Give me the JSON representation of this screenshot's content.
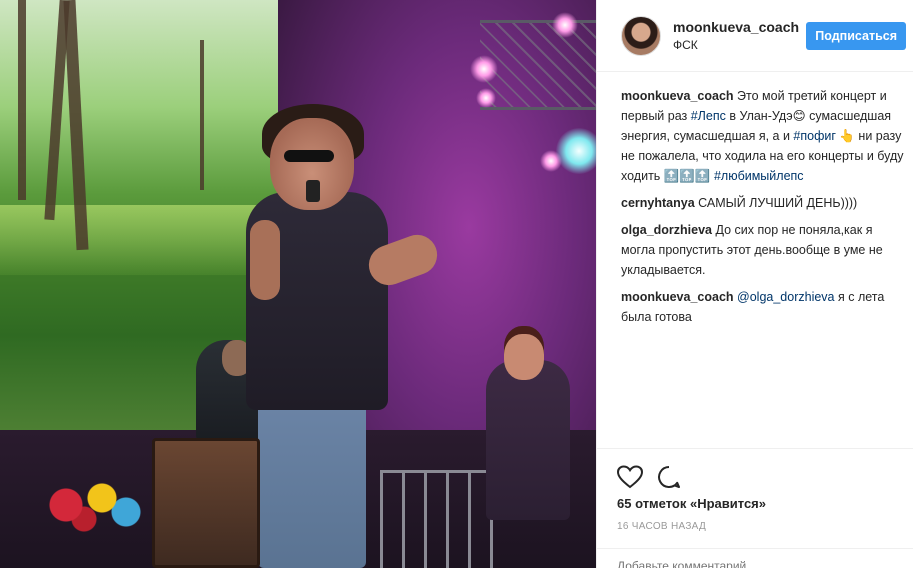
{
  "header": {
    "username": "moonkueva_coach",
    "location": "ФСК",
    "follow_label": "Подписаться"
  },
  "comments": [
    {
      "user": "moonkueva_coach",
      "parts": [
        {
          "text": "Это мой третий концерт и первый раз ",
          "tag": false
        },
        {
          "text": "#Лепс",
          "tag": true
        },
        {
          "text": " в Улан-Удэ😊 сумасшедшая энергия, сумасшедшая я, а и ",
          "tag": false
        },
        {
          "text": "#пофиг",
          "tag": true
        },
        {
          "text": " 👆 ни разу не пожалела, что ходила на его концерты и буду ходить 🔝🔝🔝 ",
          "tag": false
        },
        {
          "text": "#любимыйлепс",
          "tag": true
        }
      ]
    },
    {
      "user": "cernyhtanya",
      "parts": [
        {
          "text": "САМЫЙ ЛУЧШИЙ ДЕНЬ))))",
          "tag": false
        }
      ]
    },
    {
      "user": "olga_dorzhieva",
      "parts": [
        {
          "text": "До сих пор не поняла,как я могла пропустить этот день.вообще в уме не укладывается.",
          "tag": false
        }
      ]
    },
    {
      "user": "moonkueva_coach",
      "parts": [
        {
          "text": "@olga_dorzhieva",
          "tag": true
        },
        {
          "text": " я с лета была готова",
          "tag": false
        }
      ]
    }
  ],
  "actions": {
    "like_icon": "heart-icon",
    "comment_icon": "speech-bubble-icon",
    "likes_text": "65 отметок «Нравится»",
    "time_text": "16 часов назад"
  },
  "add_comment": {
    "placeholder": "Добавьте комментарий..."
  },
  "colors": {
    "follow_button": "#3897f0",
    "hashtag": "#003569",
    "muted": "#999999"
  }
}
